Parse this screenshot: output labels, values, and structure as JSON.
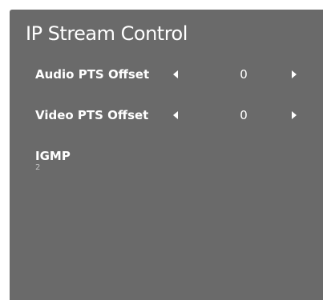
{
  "panel": {
    "title": "IP Stream Control",
    "background": "#6a6a6a"
  },
  "items": [
    {
      "label": "Audio PTS Offset",
      "value": "0"
    },
    {
      "label": "Video PTS Offset",
      "value": "0"
    }
  ],
  "igmp": {
    "label": "IGMP",
    "value": "2"
  },
  "icons": {
    "decrease": "left-triangle-icon",
    "increase": "right-triangle-icon"
  }
}
